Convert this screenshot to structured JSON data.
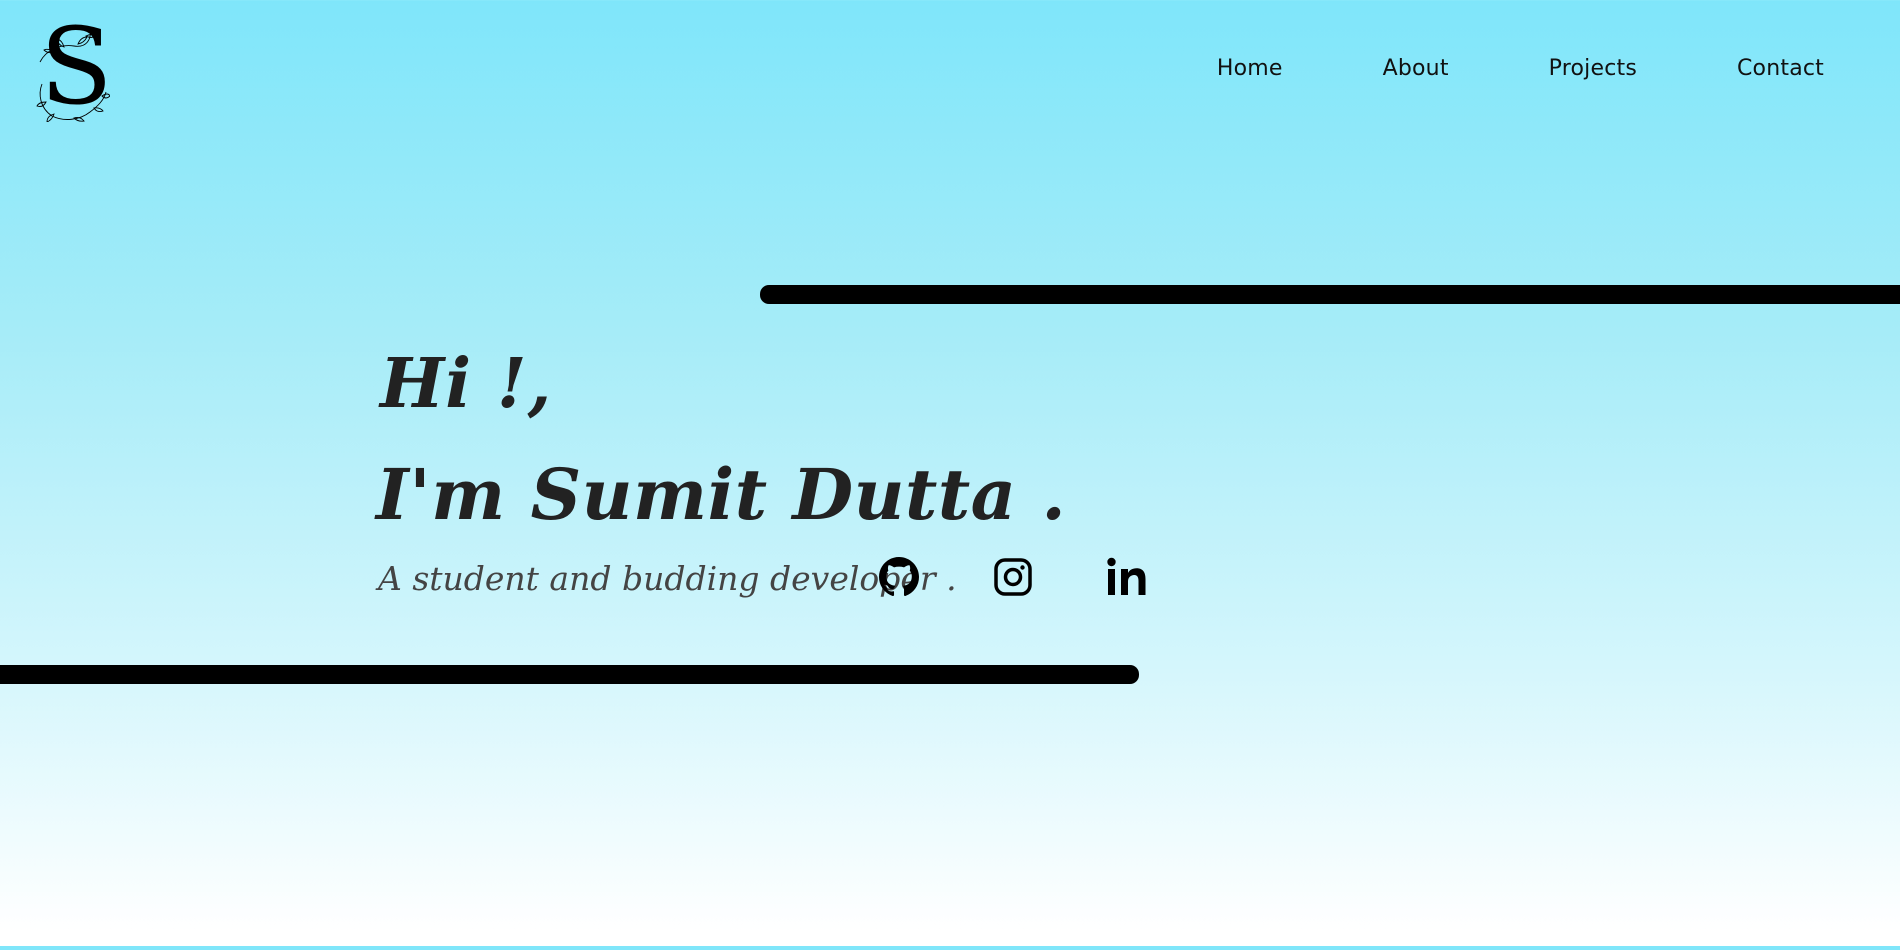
{
  "logo": {
    "letter": "S",
    "icon": "floral-s-monogram"
  },
  "nav": {
    "items": [
      {
        "label": "Home"
      },
      {
        "label": "About"
      },
      {
        "label": "Projects"
      },
      {
        "label": "Contact"
      }
    ]
  },
  "hero": {
    "greeting": "Hi !,",
    "name": "I'm Sumit Dutta .",
    "tagline": "A student and budding developer ."
  },
  "social": [
    {
      "icon": "github-icon"
    },
    {
      "icon": "instagram-icon"
    },
    {
      "icon": "linkedin-icon"
    }
  ],
  "colors": {
    "background_top": "#7fe6fa",
    "background_bottom": "#ffffff",
    "bars": "#000000",
    "text": "#222222"
  }
}
